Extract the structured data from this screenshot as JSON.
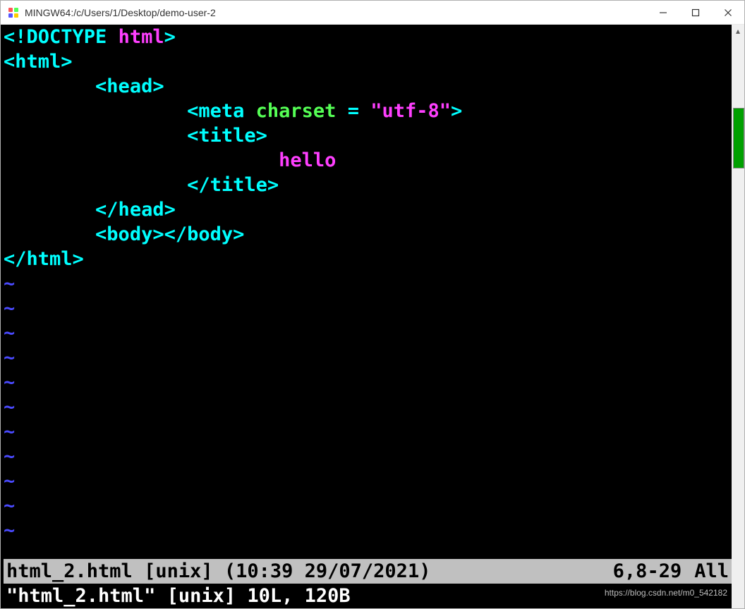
{
  "window": {
    "title": "MINGW64:/c/Users/1/Desktop/demo-user-2"
  },
  "code": {
    "l1_doctype_open": "<!DOCTYPE ",
    "l1_doctype_name": "html",
    "l1_doctype_close": ">",
    "l2_html_open": "<html>",
    "l3_indent": "        ",
    "l3_head_open": "<head>",
    "l4_indent": "                ",
    "l4_meta_open": "<meta ",
    "l4_meta_attr": "charset",
    "l4_meta_eq": " = ",
    "l4_meta_val": "\"utf-8\"",
    "l4_meta_close": ">",
    "l5_indent": "                ",
    "l5_title_open": "<title>",
    "l6_indent": "                        ",
    "l6_text": "hello",
    "l7_indent": "                ",
    "l7_title_close": "</title>",
    "l8_indent": "        ",
    "l8_head_close": "</head>",
    "l9_indent": "        ",
    "l9_body_open": "<body>",
    "l9_body_close": "</body>",
    "l10_html_close": "</html>",
    "tilde": "~"
  },
  "status": {
    "left": "html_2.html [unix] (10:39 29/07/2021)",
    "pos": "6,8-29",
    "pct": "All"
  },
  "cmdline": {
    "text": "\"html_2.html\" [unix] 10L, 120B"
  },
  "watermark": "https://blog.csdn.net/m0_542182"
}
